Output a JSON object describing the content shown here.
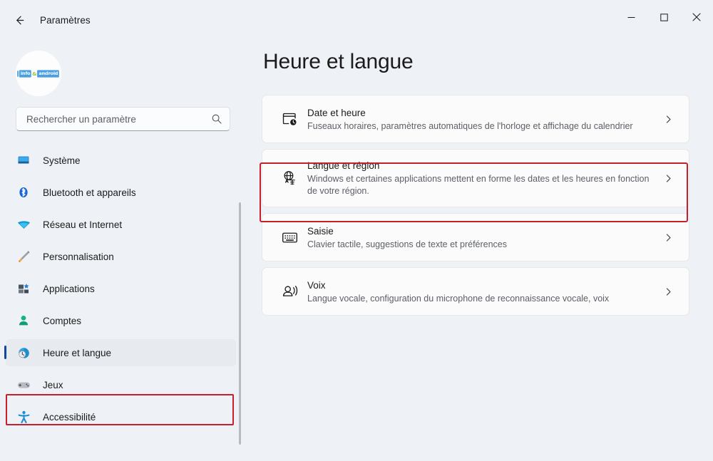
{
  "window": {
    "title": "Paramètres",
    "back_icon": "back-arrow-icon",
    "minimize_label": "Réduire",
    "maximize_label": "Agrandir",
    "close_label": "Fermer"
  },
  "profile": {
    "avatar_logo_prefix": "info",
    "avatar_logo_amp": "&",
    "avatar_logo_suffix": "android"
  },
  "search": {
    "placeholder": "Rechercher un paramètre",
    "value": "",
    "icon": "search-icon"
  },
  "sidebar": {
    "items": [
      {
        "label": "Système",
        "icon": "monitor-icon",
        "active": false
      },
      {
        "label": "Bluetooth et appareils",
        "icon": "bluetooth-icon",
        "active": false
      },
      {
        "label": "Réseau et Internet",
        "icon": "wifi-icon",
        "active": false
      },
      {
        "label": "Personnalisation",
        "icon": "paintbrush-icon",
        "active": false
      },
      {
        "label": "Applications",
        "icon": "apps-icon",
        "active": false
      },
      {
        "label": "Comptes",
        "icon": "person-icon",
        "active": false
      },
      {
        "label": "Heure et langue",
        "icon": "globe-clock-icon",
        "active": true
      },
      {
        "label": "Jeux",
        "icon": "gamepad-icon",
        "active": false
      },
      {
        "label": "Accessibilité",
        "icon": "accessibility-icon",
        "active": false
      }
    ]
  },
  "main": {
    "page_title": "Heure et langue",
    "cards": [
      {
        "title": "Date et heure",
        "desc": "Fuseaux horaires, paramètres automatiques de l'horloge et affichage du calendrier",
        "icon": "calendar-clock-icon",
        "highlighted": false
      },
      {
        "title": "Langue et région",
        "desc": "Windows et certaines applications mettent en forme les dates et les heures en fonction de votre région.",
        "icon": "language-translate-icon",
        "highlighted": true
      },
      {
        "title": "Saisie",
        "desc": "Clavier tactile, suggestions de texte et préférences",
        "icon": "keyboard-icon",
        "highlighted": false
      },
      {
        "title": "Voix",
        "desc": "Langue vocale, configuration du microphone de reconnaissance vocale, voix",
        "icon": "speech-icon",
        "highlighted": false
      }
    ],
    "chevron_icon": "chevron-right-icon"
  },
  "annotations": {
    "color": "#c8202a",
    "sidebar_target": "Heure et langue",
    "card_target": "Langue et région"
  }
}
